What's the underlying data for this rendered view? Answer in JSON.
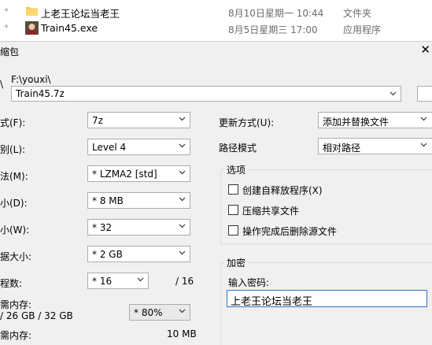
{
  "files": [
    {
      "name": "上老王论坛当老王",
      "date": "8月10日星期一 10:44",
      "type": "文件夹",
      "icon": "folder-icon"
    },
    {
      "name": "Train45.exe",
      "date": "8月5日星期三 17:00",
      "type": "应用程序",
      "icon": "app-icon"
    }
  ],
  "dialog": {
    "title": "缩包",
    "path_prefix": "F:\\youxi\\",
    "archive_name": "Train45.7z",
    "left": {
      "format_label": "式(F):",
      "format_value": "7z",
      "level_label": "别(L):",
      "level_value": "Level 4",
      "method_label": "法(M):",
      "method_value": "*  LZMA2 [std]",
      "dict_label": "小(D):",
      "dict_value": "*  8 MB",
      "word_label": "小(W):",
      "word_value": "*  32",
      "solid_label": "据大小:",
      "solid_value": "*  2 GB",
      "threads_label": "程数:",
      "threads_value": "*  16",
      "threads_max": "/ 16",
      "mem_label": "需内存:",
      "mem_info": "/ 26 GB / 32 GB",
      "mem_pct": "* 80%",
      "decomp_label": "需内存:",
      "decomp_value": "10 MB"
    },
    "right": {
      "update_label": "更新方式(U):",
      "update_value": "添加并替换文件",
      "path_label": "路径模式",
      "path_value": "相对路径",
      "options_title": "选项",
      "opt_sfx": "创建自释放程序(X)",
      "opt_shared": "压缩共享文件",
      "opt_delete": "操作完成后删除源文件",
      "encrypt_title": "加密",
      "password_label": "输入密码:",
      "password_value": "上老王论坛当老王"
    }
  }
}
